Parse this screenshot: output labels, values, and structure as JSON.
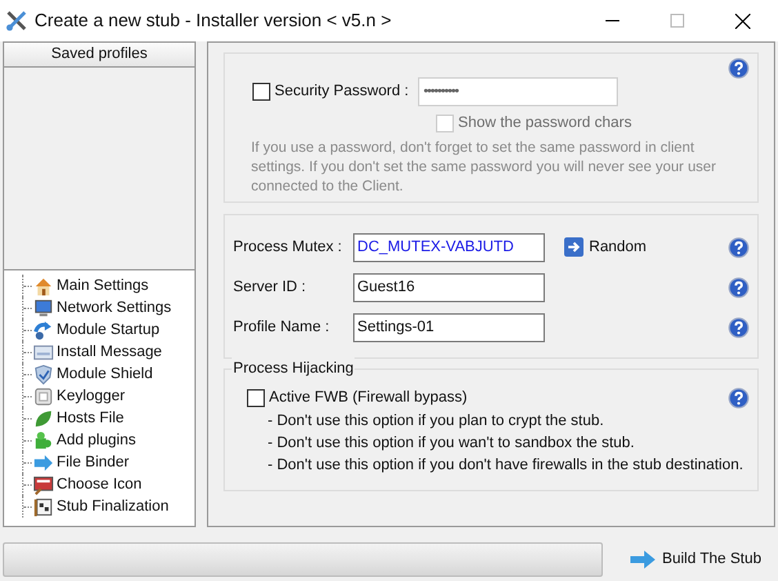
{
  "window": {
    "title": "Create a new stub - Installer version < v5.n >"
  },
  "saved_profiles": {
    "header": "Saved profiles"
  },
  "navigation": [
    {
      "label": "Main Settings",
      "selected": false
    },
    {
      "label": "Network Settings",
      "selected": false
    },
    {
      "label": "Module Startup",
      "selected": false
    },
    {
      "label": "Install Message",
      "selected": false
    },
    {
      "label": "Module Shield",
      "selected": false
    },
    {
      "label": "Keylogger",
      "selected": false
    },
    {
      "label": "Hosts File",
      "selected": false
    },
    {
      "label": "Add plugins",
      "selected": false
    },
    {
      "label": "File Binder",
      "selected": false
    },
    {
      "label": "Choose Icon",
      "selected": false
    },
    {
      "label": "Stub Finalization",
      "selected": false
    }
  ],
  "security": {
    "label": "Security Password :",
    "checked": false,
    "password": "••••••••••",
    "show_chars": {
      "label": "Show the password chars",
      "checked": false,
      "disabled": true
    },
    "note": "If you use a password, don't forget to set the same password in client settings. If you don't set the same password you will never see your user connected to the Client."
  },
  "identity": {
    "fields": [
      {
        "label": "Process Mutex :",
        "value": "DC_MUTEX-VABJUTD",
        "highlighted": true
      },
      {
        "label": "Server ID :",
        "value": "Guest16",
        "highlighted": false
      },
      {
        "label": "Profile Name :",
        "value": "Settings-01",
        "highlighted": false
      }
    ],
    "random_button": "Random"
  },
  "process_hijacking": {
    "title": "Process Hijacking",
    "label": "Active FWB (Firewall bypass)",
    "checked": false,
    "notes": [
      "- Don't use this option if you plan to crypt the stub.",
      "- Don't use this option if you wan't to sandbox the stub.",
      "- Don't use this option if you don't have firewalls in the stub destination."
    ]
  },
  "progress": {
    "level": 0
  },
  "build_button": "Build The Stub"
}
